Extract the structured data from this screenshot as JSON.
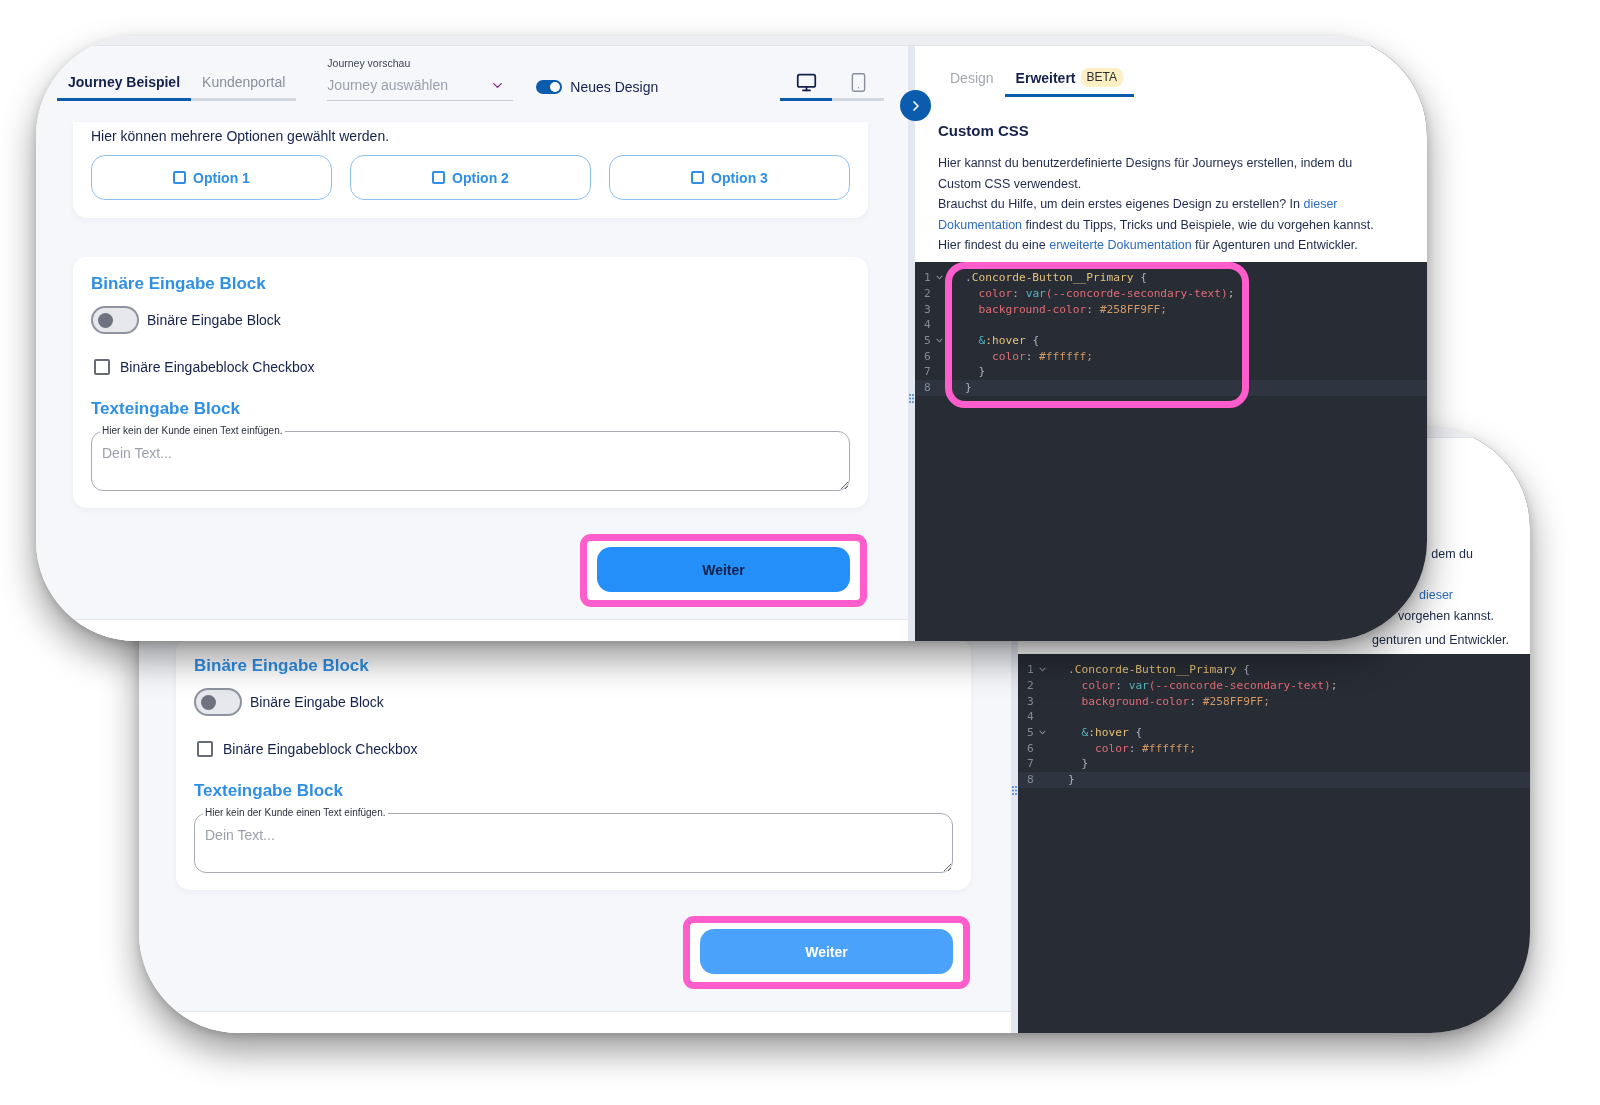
{
  "front_window": {
    "header": {
      "tabs": [
        {
          "label": "Journey Beispiel",
          "selected": true
        },
        {
          "label": "Kundenportal",
          "selected": false
        }
      ],
      "journey_select": {
        "label": "Journey vorschau",
        "placeholder": "Journey auswählen"
      },
      "design_toggle": {
        "label": "Neues Design",
        "on": true
      },
      "device_tabs": [
        {
          "kind": "desktop",
          "selected": true
        },
        {
          "kind": "mobile",
          "selected": false
        }
      ]
    },
    "options_card": {
      "prompt": "Hier können mehrere Optionen gewählt werden.",
      "options": [
        {
          "label": "Option 1",
          "checked": false
        },
        {
          "label": "Option 2",
          "checked": false
        },
        {
          "label": "Option 3",
          "checked": false
        }
      ]
    },
    "input_card": {
      "title": "Binäre Eingabe Block",
      "toggle": {
        "label": "Binäre Eingabe Block",
        "on": false
      },
      "checkbox": {
        "label": "Binäre Eingabeblock Checkbox",
        "checked": false
      },
      "text_title": "Texteingabe Block",
      "text_field": {
        "label": "Hier kein der Kunde einen Text einfügen.",
        "placeholder": "Dein Text..."
      }
    },
    "next_button": {
      "label": "Weiter",
      "hovered": false,
      "highlighted": true
    },
    "side_panel": {
      "tabs": [
        {
          "label": "Design",
          "selected": false
        },
        {
          "label": "Erweitert",
          "badge": "BETA",
          "selected": true
        }
      ],
      "title": "Custom CSS",
      "paragraphs": [
        {
          "lines": [
            [
              {
                "text": "Hier kannst du benutzerdefinierte Designs für Journeys erstellen, indem du",
                "kind": "plain"
              }
            ],
            [
              {
                "text": "Custom CSS verwendest.",
                "kind": "plain"
              }
            ]
          ]
        },
        {
          "lines": [
            [
              {
                "text": "Brauchst du Hilfe, um dein erstes eigenes Design zu erstellen? In ",
                "kind": "plain"
              },
              {
                "text": "dieser",
                "kind": "link"
              }
            ],
            [
              {
                "text": "Dokumentation",
                "kind": "link"
              },
              {
                "text": " findest du Tipps, Tricks und Beispiele, wie du vorgehen kannst.",
                "kind": "plain"
              }
            ]
          ]
        },
        {
          "lines": [
            [
              {
                "text": "Hier findest du eine ",
                "kind": "plain"
              },
              {
                "text": "erweiterte Dokumentation",
                "kind": "link"
              },
              {
                "text": " für Agenturen und Entwickler.",
                "kind": "plain"
              }
            ]
          ]
        }
      ],
      "code": {
        "highlighted": true,
        "lines": [
          {
            "number": "1",
            "foldable": true,
            "active": false,
            "tokens": [
              {
                "text": ".",
                "kind": "punct"
              },
              {
                "text": "Concorde-Button__Primary",
                "kind": "selector"
              },
              {
                "text": " {",
                "kind": "punct"
              }
            ]
          },
          {
            "number": "2",
            "foldable": false,
            "active": false,
            "tokens": [
              {
                "text": "  color",
                "kind": "property"
              },
              {
                "text": ": ",
                "kind": "punct"
              },
              {
                "text": "var",
                "kind": "function"
              },
              {
                "text": "(--concorde-secondary-text)",
                "kind": "variable"
              },
              {
                "text": ";",
                "kind": "punct"
              }
            ]
          },
          {
            "number": "3",
            "foldable": false,
            "active": false,
            "tokens": [
              {
                "text": "  background-color",
                "kind": "property"
              },
              {
                "text": ": ",
                "kind": "punct"
              },
              {
                "text": "#258FF9FF;",
                "kind": "value"
              }
            ]
          },
          {
            "number": "4",
            "foldable": false,
            "active": false
          },
          {
            "number": "5",
            "foldable": true,
            "active": false,
            "tokens": [
              {
                "text": "  &",
                "kind": "nesting"
              },
              {
                "text": ":hover",
                "kind": "pseudo"
              },
              {
                "text": " {",
                "kind": "punct"
              }
            ]
          },
          {
            "number": "6",
            "foldable": false,
            "active": false,
            "tokens": [
              {
                "text": "    color",
                "kind": "property"
              },
              {
                "text": ": ",
                "kind": "punct"
              },
              {
                "text": "#ffffff;",
                "kind": "value"
              }
            ]
          },
          {
            "number": "7",
            "foldable": false,
            "active": false,
            "tokens": [
              {
                "text": "  }",
                "kind": "punct"
              }
            ]
          },
          {
            "number": "8",
            "foldable": false,
            "active": true,
            "tokens": [
              {
                "text": "}",
                "kind": "punct"
              }
            ]
          }
        ]
      }
    }
  },
  "back_window": {
    "input_card": {
      "title": "Binäre Eingabe Block",
      "toggle": {
        "label": "Binäre Eingabe Block",
        "on": false
      },
      "checkbox": {
        "label": "Binäre Eingabeblock Checkbox",
        "checked": false
      },
      "text_title": "Texteingabe Block",
      "text_field": {
        "label": "Hier kein der Kunde einen Text einfügen.",
        "placeholder": "Dein Text..."
      }
    },
    "next_button": {
      "label": "Weiter",
      "hovered": true,
      "highlighted": true
    },
    "side_panel": {
      "text_fragments": [
        {
          "text": "dem du",
          "kind": "plain"
        },
        {
          "text": "dieser",
          "kind": "link"
        },
        {
          "text": "vorgehen kannst.",
          "kind": "plain"
        },
        {
          "text": "genturen und Entwickler.",
          "kind": "plain"
        }
      ],
      "code": {
        "highlighted": false,
        "lines": [
          {
            "number": "1",
            "foldable": true,
            "active": false,
            "tokens": [
              {
                "text": ".",
                "kind": "punct"
              },
              {
                "text": "Concorde-Button__Primary",
                "kind": "selector"
              },
              {
                "text": " {",
                "kind": "punct"
              }
            ]
          },
          {
            "number": "2",
            "foldable": false,
            "active": false,
            "tokens": [
              {
                "text": "  color",
                "kind": "property"
              },
              {
                "text": ": ",
                "kind": "punct"
              },
              {
                "text": "var",
                "kind": "function"
              },
              {
                "text": "(--concorde-secondary-text)",
                "kind": "variable"
              },
              {
                "text": ";",
                "kind": "punct"
              }
            ]
          },
          {
            "number": "3",
            "foldable": false,
            "active": false,
            "tokens": [
              {
                "text": "  background-color",
                "kind": "property"
              },
              {
                "text": ": ",
                "kind": "punct"
              },
              {
                "text": "#258FF9FF;",
                "kind": "value"
              }
            ]
          },
          {
            "number": "4",
            "foldable": false,
            "active": false
          },
          {
            "number": "5",
            "foldable": true,
            "active": false,
            "tokens": [
              {
                "text": "  &",
                "kind": "nesting"
              },
              {
                "text": ":hover",
                "kind": "pseudo"
              },
              {
                "text": " {",
                "kind": "punct"
              }
            ]
          },
          {
            "number": "6",
            "foldable": false,
            "active": false,
            "tokens": [
              {
                "text": "    color",
                "kind": "property"
              },
              {
                "text": ": ",
                "kind": "punct"
              },
              {
                "text": "#ffffff;",
                "kind": "value"
              }
            ]
          },
          {
            "number": "7",
            "foldable": false,
            "active": false,
            "tokens": [
              {
                "text": "  }",
                "kind": "punct"
              }
            ]
          },
          {
            "number": "8",
            "foldable": false,
            "active": true,
            "tokens": [
              {
                "text": "}",
                "kind": "punct"
              }
            ]
          }
        ]
      }
    }
  }
}
